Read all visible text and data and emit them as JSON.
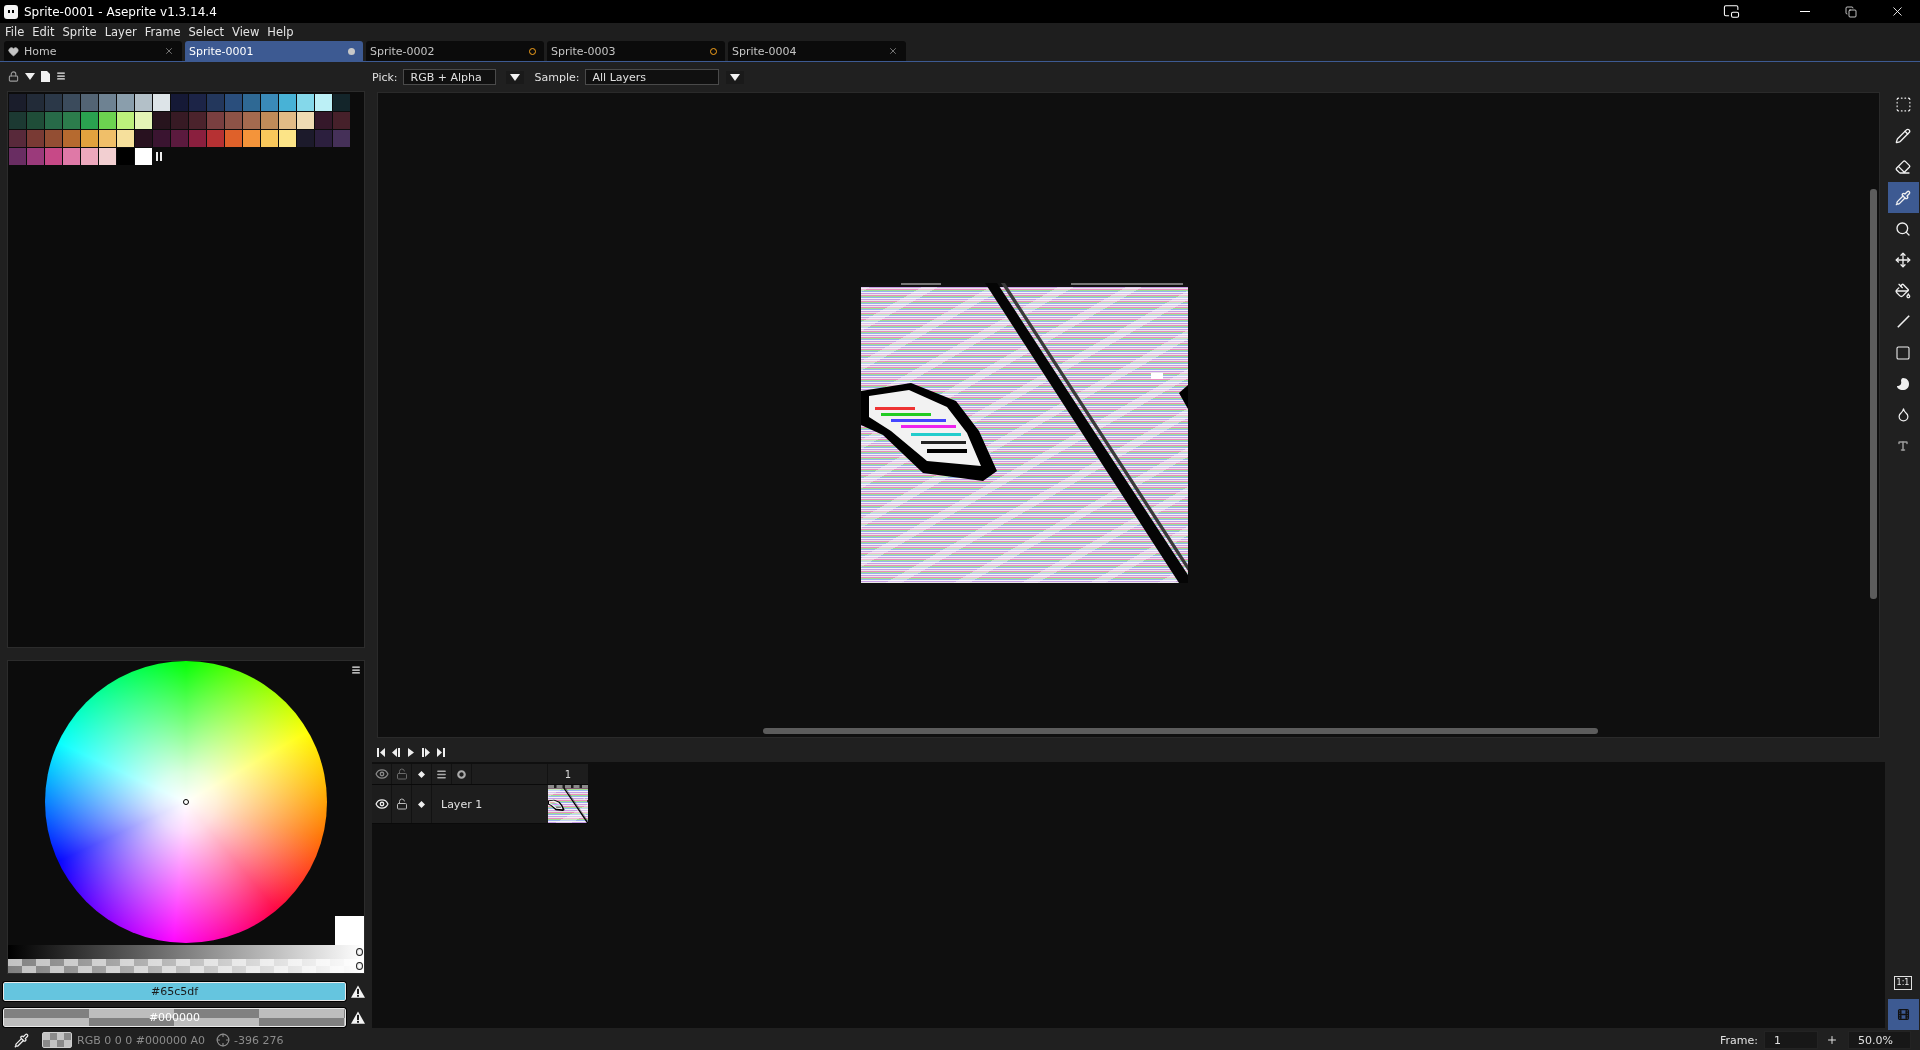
{
  "window": {
    "title": "Sprite-0001 - Aseprite v1.3.14.4"
  },
  "menu": [
    "File",
    "Edit",
    "Sprite",
    "Layer",
    "Frame",
    "Select",
    "View",
    "Help"
  ],
  "tabs": [
    {
      "label": "Home",
      "kind": "home",
      "selected": false,
      "modified": false
    },
    {
      "label": "Sprite-0001",
      "kind": "sprite",
      "selected": true,
      "modified": true
    },
    {
      "label": "Sprite-0002",
      "kind": "sprite",
      "selected": false,
      "modified": true
    },
    {
      "label": "Sprite-0003",
      "kind": "sprite",
      "selected": false,
      "modified": true
    },
    {
      "label": "Sprite-0004",
      "kind": "sprite",
      "selected": false,
      "modified": false
    }
  ],
  "palette": {
    "swatches": [
      {
        "color": "#1a1d2b"
      },
      {
        "color": "#222b38"
      },
      {
        "color": "#2b3848"
      },
      {
        "color": "#3b4b5c"
      },
      {
        "color": "#536474"
      },
      {
        "color": "#6e8292"
      },
      {
        "color": "#8a9eac"
      },
      {
        "color": "#b3c0c8"
      },
      {
        "color": "#dde4e8"
      },
      {
        "color": "#151936"
      },
      {
        "color": "#1c2447"
      },
      {
        "color": "#23375c"
      },
      {
        "color": "#2a4e7c"
      },
      {
        "color": "#2f6994"
      },
      {
        "color": "#3a8ab8"
      },
      {
        "color": "#48b2d6"
      },
      {
        "color": "#84d8ea"
      },
      {
        "color": "#bcf0f6"
      },
      {
        "color": "#13252a"
      },
      {
        "color": "#1c3932"
      },
      {
        "color": "#1f4d38"
      },
      {
        "color": "#276a48"
      },
      {
        "color": "#2c7c4c"
      },
      {
        "color": "#2aa250"
      },
      {
        "color": "#6cd350"
      },
      {
        "color": "#bdf17c"
      },
      {
        "color": "#e4f5b6"
      },
      {
        "color": "#27141d"
      },
      {
        "color": "#371a24"
      },
      {
        "color": "#4b232c"
      },
      {
        "color": "#793f40"
      },
      {
        "color": "#8d5347"
      },
      {
        "color": "#a46a4f"
      },
      {
        "color": "#bf8b59"
      },
      {
        "color": "#e2bb86"
      },
      {
        "color": "#efdbb3"
      },
      {
        "color": "#35182a"
      },
      {
        "color": "#46202a"
      },
      {
        "color": "#58293a"
      },
      {
        "color": "#793a34"
      },
      {
        "color": "#934e33"
      },
      {
        "color": "#b66a2f"
      },
      {
        "color": "#e2a23e"
      },
      {
        "color": "#f0bf69"
      },
      {
        "color": "#f6e09c"
      },
      {
        "color": "#28111f"
      },
      {
        "color": "#3a1430"
      },
      {
        "color": "#5b1a3e"
      },
      {
        "color": "#8a1f3e"
      },
      {
        "color": "#b63133"
      },
      {
        "color": "#df612a"
      },
      {
        "color": "#f4943a"
      },
      {
        "color": "#f9c85b"
      },
      {
        "color": "#fce487"
      },
      {
        "color": "#1c1a2b"
      },
      {
        "color": "#2c1f3e"
      },
      {
        "color": "#453058"
      },
      {
        "color": "#692d62"
      },
      {
        "color": "#9b3a7b"
      },
      {
        "color": "#c74987"
      },
      {
        "color": "#df79a7"
      },
      {
        "color": "#eda8bd"
      },
      {
        "color": "#f2cfd1"
      },
      {
        "color": "#000000"
      },
      {
        "color": "#ffffff"
      }
    ]
  },
  "color_sliders": [
    {
      "kind": "value",
      "level": 1
    },
    {
      "kind": "alpha",
      "level": 1
    }
  ],
  "foreground": {
    "label": "#65c5df",
    "color": "#65c5df"
  },
  "background": {
    "label": "#000000"
  },
  "pick_bar": {
    "pick_label": "Pick:",
    "pick_value": "RGB + Alpha",
    "sample_label": "Sample:",
    "sample_value": "All Layers"
  },
  "timeline": {
    "frames": [
      "1"
    ],
    "layers": [
      {
        "name": "Layer 1",
        "visible": true,
        "locked": false
      }
    ]
  },
  "tools": [
    {
      "kind": "marquee",
      "selected": false
    },
    {
      "kind": "pencil",
      "selected": false
    },
    {
      "kind": "eraser",
      "selected": false
    },
    {
      "kind": "eyedropper",
      "selected": true
    },
    {
      "kind": "zoom",
      "selected": false
    },
    {
      "kind": "move",
      "selected": false
    },
    {
      "kind": "bucket",
      "selected": false
    },
    {
      "kind": "line",
      "selected": false
    },
    {
      "kind": "rectangle",
      "selected": false
    },
    {
      "kind": "contour",
      "selected": false
    },
    {
      "kind": "blur",
      "selected": false
    },
    {
      "kind": "text",
      "selected": false
    }
  ],
  "view_buttons": {
    "actual_size": "1:1",
    "timeline_selected": true
  },
  "status_bar": {
    "color_info": "RGB 0 0 0 #000000 A0",
    "position": "-396 276",
    "frame_label": "Frame:",
    "frame": "1",
    "zoom": "50.0%"
  }
}
